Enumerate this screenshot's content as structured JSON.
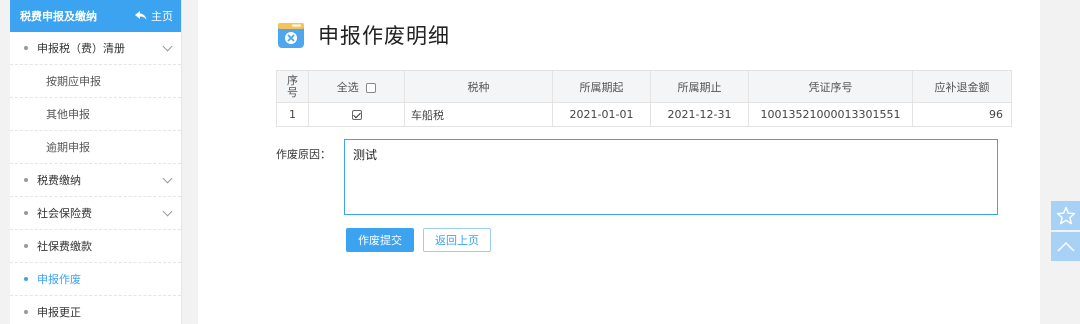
{
  "sidebar": {
    "header_title": "税费申报及缴纳",
    "home_label": "主页",
    "items": [
      {
        "label": "申报税（费）清册"
      },
      {
        "label": "按期应申报"
      },
      {
        "label": "其他申报"
      },
      {
        "label": "逾期申报"
      },
      {
        "label": "税费缴纳"
      },
      {
        "label": "社会保险费"
      },
      {
        "label": "社保费缴款"
      },
      {
        "label": "申报作废"
      },
      {
        "label": "申报更正"
      }
    ]
  },
  "page": {
    "title": "申报作废明细"
  },
  "table": {
    "headers": {
      "seq": "序号",
      "select_all": "全选",
      "tax_type": "税种",
      "period_start": "所属期起",
      "period_end": "所属期止",
      "voucher_no": "凭证序号",
      "amount": "应补退金额"
    },
    "rows": [
      {
        "seq": "1",
        "checked": true,
        "tax_type": "车船税",
        "period_start": "2021-01-01",
        "period_end": "2021-12-31",
        "voucher_no": "10013521000013301551",
        "amount": "96"
      }
    ]
  },
  "form": {
    "reason_label": "作废原因：",
    "reason_value": "测试",
    "submit_label": "作废提交",
    "back_label": "返回上页"
  },
  "colors": {
    "accent": "#3ba3f0",
    "float_bg": "#a7d2f5"
  }
}
